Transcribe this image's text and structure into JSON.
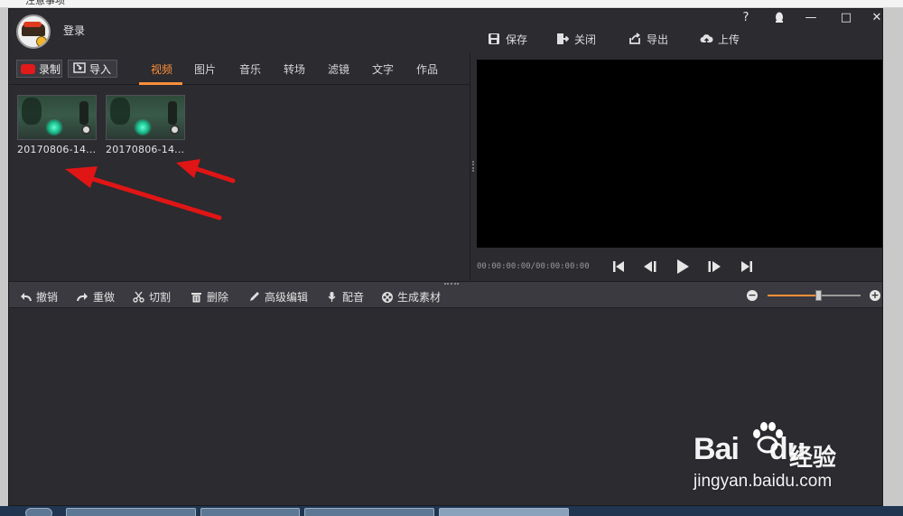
{
  "background_window": {
    "title_partial": "注意事项"
  },
  "titlebar": {
    "login_label": "登录",
    "help_label": "?",
    "minimize_label": "—",
    "maximize_label": "□",
    "close_label": "✕"
  },
  "top_actions": [
    {
      "label": "保存",
      "icon": "save-icon"
    },
    {
      "label": "关闭",
      "icon": "exit-icon"
    },
    {
      "label": "导出",
      "icon": "export-icon"
    },
    {
      "label": "上传",
      "icon": "upload-icon"
    }
  ],
  "left_toolbar": {
    "record_label": "录制",
    "import_label": "导入"
  },
  "tabs": [
    {
      "label": "视频",
      "active": true
    },
    {
      "label": "图片",
      "active": false
    },
    {
      "label": "音乐",
      "active": false
    },
    {
      "label": "转场",
      "active": false
    },
    {
      "label": "滤镜",
      "active": false
    },
    {
      "label": "文字",
      "active": false
    },
    {
      "label": "作品",
      "active": false
    }
  ],
  "media_items": [
    {
      "caption": "20170806-14..."
    },
    {
      "caption": "20170806-14..."
    }
  ],
  "player": {
    "timecode": "00:00:00:00/00:00:00:00",
    "controls": [
      "skip-start-icon",
      "step-back-icon",
      "play-icon",
      "step-forward-icon",
      "skip-end-icon"
    ]
  },
  "edit_toolbar": [
    {
      "label": "撤销",
      "icon": "undo-icon"
    },
    {
      "label": "重做",
      "icon": "redo-icon"
    },
    {
      "label": "切割",
      "icon": "scissors-icon"
    },
    {
      "label": "删除",
      "icon": "trash-icon"
    },
    {
      "label": "高级编辑",
      "icon": "pen-icon"
    },
    {
      "label": "配音",
      "icon": "microphone-icon"
    },
    {
      "label": "生成素材",
      "icon": "film-reel-icon"
    }
  ],
  "zoom": {
    "minus": "−",
    "plus": "+",
    "level_fraction": 0.55
  },
  "watermark": {
    "brand_bai": "Bai",
    "brand_du": "du",
    "brand_cn": "经验",
    "url": "jingyan.baidu.com"
  },
  "colors": {
    "accent": "#ff8f3a",
    "panel": "#2b2b30",
    "toolbar": "#3a3a40",
    "annotation_arrow": "#e01515"
  }
}
